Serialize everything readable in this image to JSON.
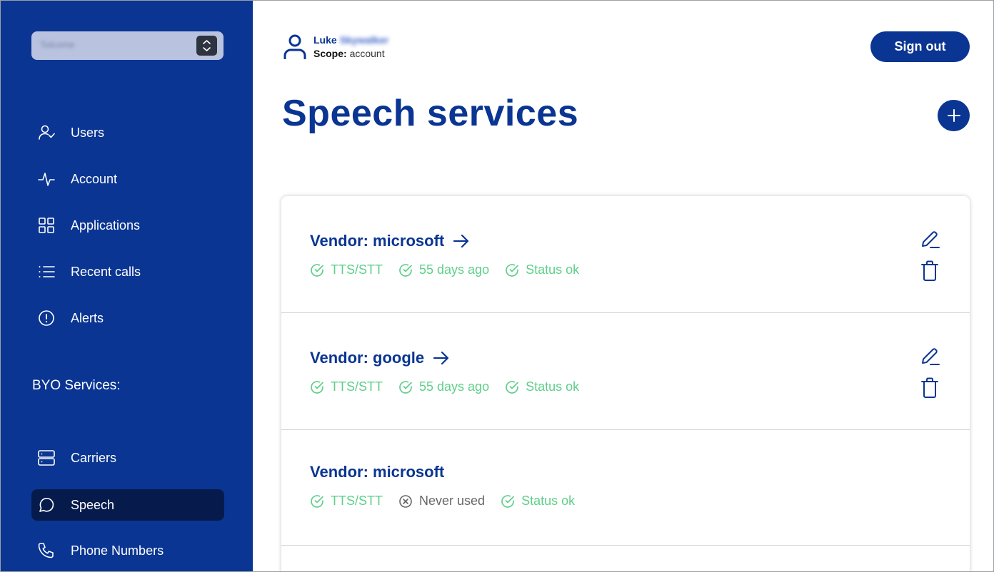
{
  "sidebar": {
    "account_select_value": "Tolcome",
    "nav": [
      {
        "label": "Users",
        "icon": "user-check-icon"
      },
      {
        "label": "Account",
        "icon": "activity-icon"
      },
      {
        "label": "Applications",
        "icon": "grid-icon"
      },
      {
        "label": "Recent calls",
        "icon": "list-icon"
      },
      {
        "label": "Alerts",
        "icon": "alert-circle-icon"
      }
    ],
    "byo_title": "BYO Services:",
    "byo": [
      {
        "label": "Carriers",
        "icon": "server-icon"
      },
      {
        "label": "Speech",
        "icon": "message-circle-icon",
        "active": true
      },
      {
        "label": "Phone Numbers",
        "icon": "phone-icon"
      }
    ]
  },
  "header": {
    "user_first": "Luke",
    "user_last": "Skywalker",
    "scope_label": "Scope:",
    "scope_value": "account",
    "signout_label": "Sign out"
  },
  "page": {
    "title": "Speech services"
  },
  "services": [
    {
      "vendor": "Vendor: microsoft",
      "linked": true,
      "usage": "TTS/STT",
      "last_used": "55 days ago",
      "last_used_ok": true,
      "status": "Status ok"
    },
    {
      "vendor": "Vendor: google",
      "linked": true,
      "usage": "TTS/STT",
      "last_used": "55 days ago",
      "last_used_ok": true,
      "status": "Status ok"
    },
    {
      "vendor": "Vendor: microsoft",
      "linked": false,
      "usage": "TTS/STT",
      "last_used": "Never used",
      "last_used_ok": false,
      "status": "Status ok"
    }
  ],
  "colors": {
    "brand": "#0a3592",
    "active_nav": "#061b4c",
    "success": "#5fcf8a"
  }
}
